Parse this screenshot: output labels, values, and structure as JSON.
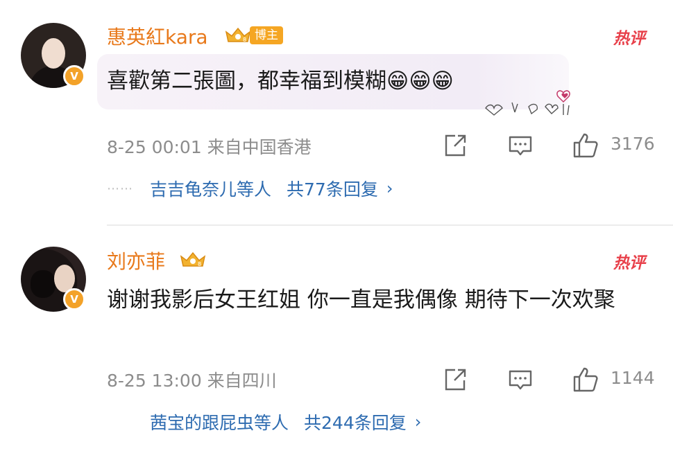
{
  "comments": [
    {
      "username": "惠英紅kara",
      "role_tag": "博主",
      "hot_label": "热评",
      "text": "喜歡第二張圖，都幸福到模糊😁😁😁",
      "meta": "8-25 00:01 来自中国香港",
      "likes": "3176",
      "reply_people": "吉吉龟奈儿等人",
      "reply_count": "共77条回复",
      "reply_dots": "⋯⋯"
    },
    {
      "username": "刘亦菲",
      "hot_label": "热评",
      "text": "谢谢我影后女王红姐 你一直是我偶像 期待下一次欢聚",
      "meta": "8-25 13:00 来自四川",
      "likes": "1144",
      "reply_people": "茜宝的跟屁虫等人",
      "reply_count": "共244条回复"
    }
  ],
  "colors": {
    "username": "#e8791b",
    "link": "#2d6bb0",
    "meta": "#8c8c8c",
    "hot": "#e8404a",
    "badge": "#f3a229"
  },
  "icons": [
    "share-icon",
    "comment-icon",
    "like-icon",
    "verified-v-icon",
    "crown-icon",
    "chevron-right-icon"
  ]
}
